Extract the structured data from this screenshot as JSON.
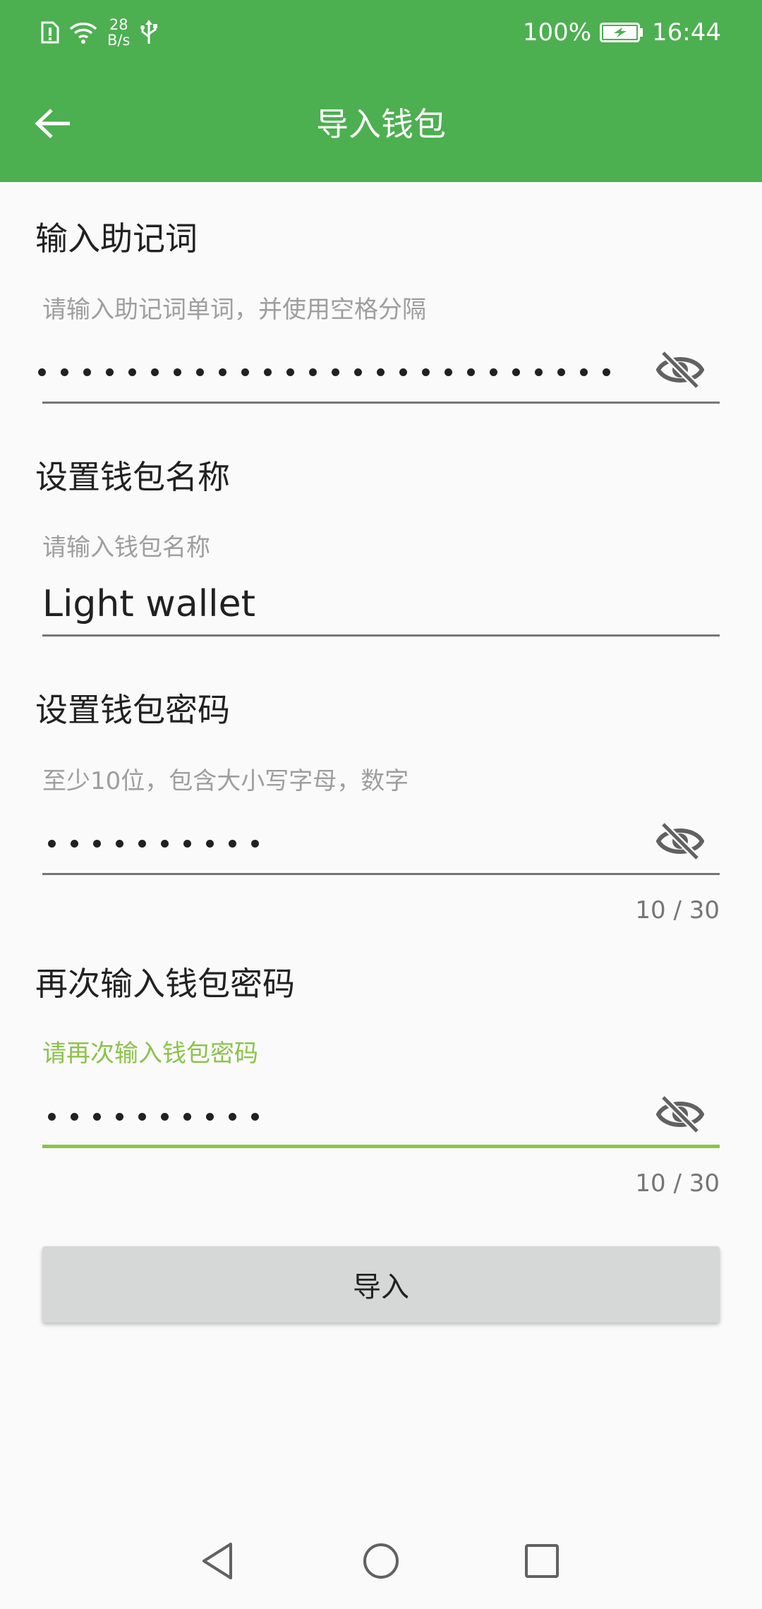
{
  "status_bar": {
    "net_speed_value": "28",
    "net_speed_unit": "B/s",
    "battery": "100%",
    "time": "16:44"
  },
  "app_bar": {
    "title": "导入钱包"
  },
  "mnemonic": {
    "label": "输入助记词",
    "hint": "请输入助记词单词，并使用空格分隔",
    "masked": true
  },
  "wallet_name": {
    "label": "设置钱包名称",
    "hint": "请输入钱包名称",
    "value": "Light wallet"
  },
  "password": {
    "label": "设置钱包密码",
    "hint": "至少10位，包含大小写字母，数字",
    "masked": true,
    "counter": "10 / 30"
  },
  "confirm_password": {
    "label": "再次输入钱包密码",
    "hint": "请再次输入钱包密码",
    "masked": true,
    "counter": "10 / 30"
  },
  "import_button": {
    "label": "导入"
  },
  "colors": {
    "primary": "#4caf50",
    "accent": "#8bc34a",
    "button_bg": "#d6d7d7"
  }
}
